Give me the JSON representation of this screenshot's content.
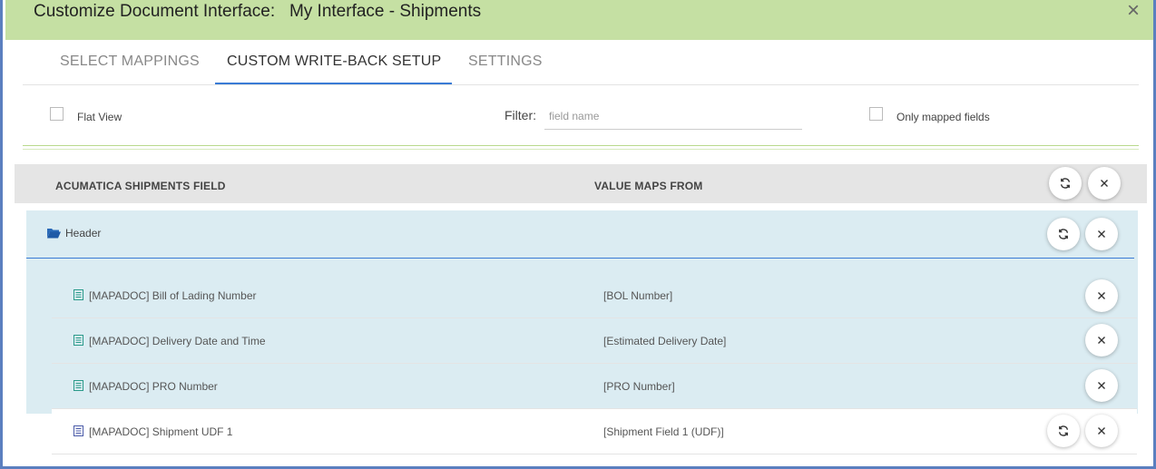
{
  "dialog": {
    "title": "Customize Document Interface:   My Interface - Shipments",
    "close_glyph": "×"
  },
  "tabs": [
    {
      "label": "SELECT MAPPINGS",
      "active": false
    },
    {
      "label": "CUSTOM WRITE-BACK SETUP",
      "active": true
    },
    {
      "label": "SETTINGS",
      "active": false
    }
  ],
  "filters": {
    "flat_view_label": "Flat View",
    "filter_label": "Filter:",
    "filter_placeholder": "field name",
    "filter_value": "",
    "only_mapped_label": "Only mapped fields"
  },
  "grid": {
    "col_field": "ACUMATICA SHIPMENTS FIELD",
    "col_value": "VALUE MAPS FROM",
    "group": {
      "title": "Header",
      "icon": "folder-open-icon",
      "rows": [
        {
          "field": "[MAPADOC] Bill of Lading Number",
          "value": "[BOL Number]",
          "icon": "list-icon",
          "reset": false
        },
        {
          "field": "[MAPADOC] Delivery Date and Time",
          "value": "[Estimated Delivery Date]",
          "icon": "list-icon",
          "reset": false
        },
        {
          "field": "[MAPADOC] PRO Number",
          "value": "[PRO Number]",
          "icon": "list-icon",
          "reset": false
        }
      ]
    },
    "ungrouped_rows": [
      {
        "field": "[MAPADOC] Shipment UDF 1",
        "value": "[Shipment Field 1 (UDF)]",
        "icon": "list-icon",
        "reset": true
      }
    ]
  },
  "colors": {
    "titlebar": "#c5e0a3",
    "accent": "#3a7bd5",
    "group_bg": "#dbecf2",
    "header_bg": "#e5e5e5",
    "frame": "#5b7fbf"
  }
}
